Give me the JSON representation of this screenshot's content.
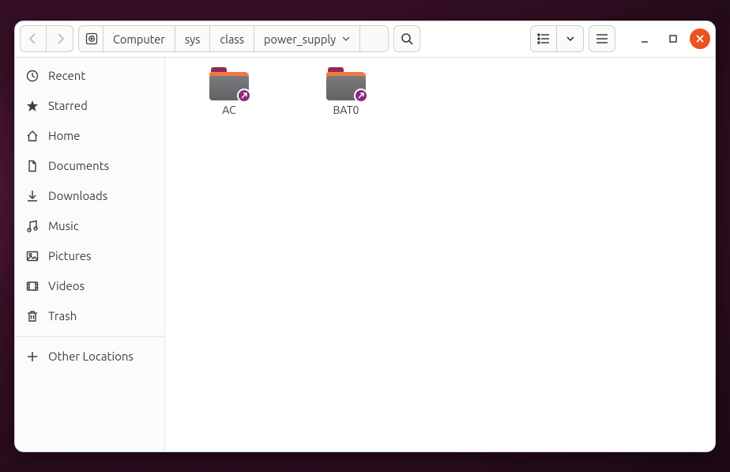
{
  "path": {
    "root": "Computer",
    "segments": [
      "sys",
      "class",
      "power_supply"
    ]
  },
  "sidebar": {
    "items": [
      {
        "id": "recent",
        "label": "Recent"
      },
      {
        "id": "starred",
        "label": "Starred"
      },
      {
        "id": "home",
        "label": "Home"
      },
      {
        "id": "documents",
        "label": "Documents"
      },
      {
        "id": "downloads",
        "label": "Downloads"
      },
      {
        "id": "music",
        "label": "Music"
      },
      {
        "id": "pictures",
        "label": "Pictures"
      },
      {
        "id": "videos",
        "label": "Videos"
      },
      {
        "id": "trash",
        "label": "Trash"
      }
    ],
    "other_locations": "Other Locations"
  },
  "files": [
    {
      "name": "AC",
      "type": "folder-link"
    },
    {
      "name": "BAT0",
      "type": "folder-link"
    }
  ]
}
